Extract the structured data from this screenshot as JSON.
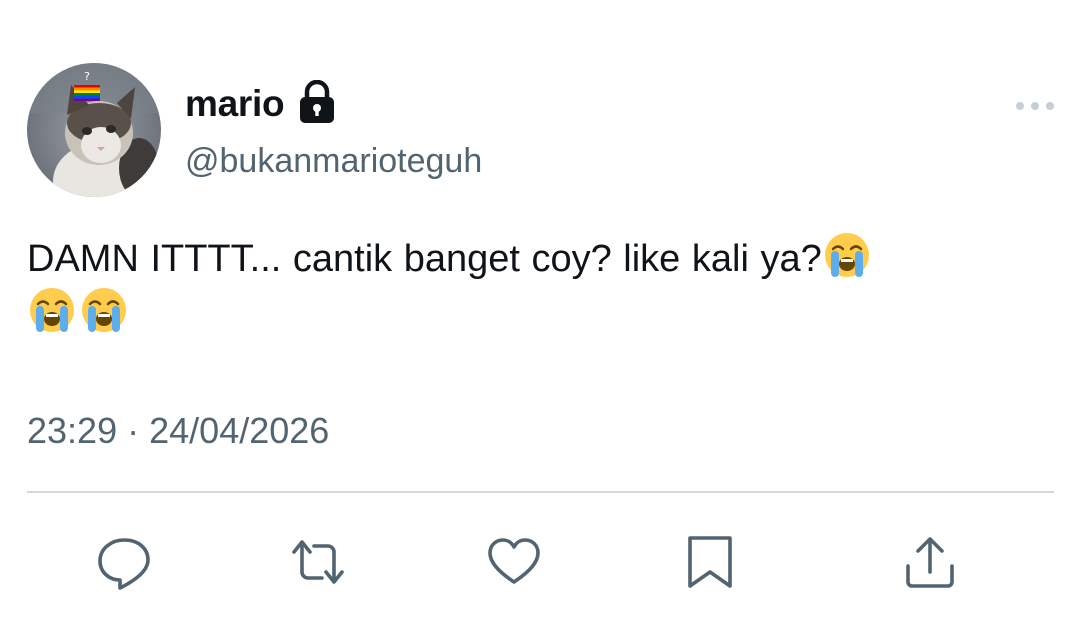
{
  "tweet": {
    "author": {
      "display_name": "mario",
      "handle": "@bukanmarioteguh",
      "protected": true,
      "avatar_icon": "cat-with-rainbow-flag-avatar"
    },
    "text": "DAMN ITTTT... cantik banget coy? like kali ya?",
    "emoji": [
      "loudly-crying-face",
      "loudly-crying-face",
      "loudly-crying-face"
    ],
    "time": "23:29",
    "date": "24/04/2026",
    "separator": "·"
  },
  "menu": {
    "icon": "more-horizontal-icon"
  },
  "actions": [
    {
      "name": "reply",
      "icon": "reply-icon"
    },
    {
      "name": "retweet",
      "icon": "retweet-icon"
    },
    {
      "name": "like",
      "icon": "heart-icon"
    },
    {
      "name": "bookmark",
      "icon": "bookmark-icon"
    },
    {
      "name": "share",
      "icon": "share-icon"
    }
  ],
  "colors": {
    "text_primary": "#0f1419",
    "text_secondary": "#536471",
    "divider": "#cfd9de",
    "icon": "#536471"
  }
}
